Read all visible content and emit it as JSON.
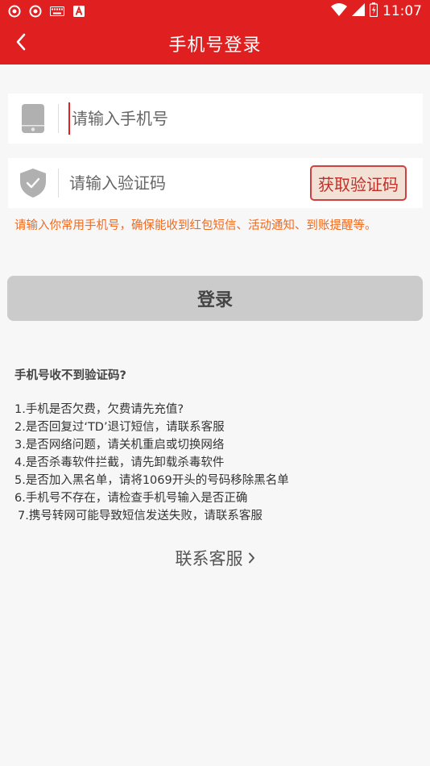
{
  "status_bar": {
    "time": "11:07",
    "left_icons": [
      "app-notification-icon",
      "app-notification-icon",
      "keyboard-icon",
      "text-icon"
    ],
    "right_icons": [
      "wifi-icon",
      "signal-icon",
      "battery-icon"
    ]
  },
  "app_bar": {
    "title": "手机号登录",
    "back_icon": "chevron-left-icon",
    "color": "#e02020"
  },
  "form": {
    "phone": {
      "placeholder": "请输入手机号",
      "value": "",
      "icon": "phone-icon"
    },
    "code": {
      "placeholder": "请输入验证码",
      "value": "",
      "icon": "shield-check-icon"
    },
    "get_code_label": "获取验证码",
    "hint": "请输入你常用手机号，确保能收到红包短信、活动通知、到账提醒等。",
    "login_label": "登录"
  },
  "help": {
    "title": "手机号收不到验证码?",
    "items": [
      "1.手机是否欠费，欠费请先充值?",
      "2.是否回复过‘TD’退订短信，请联系客服",
      "3.是否网络问题，请关机重启或切换网络",
      "4.是否杀毒软件拦截，请先卸载杀毒软件",
      "5.是否加入黑名单，请将1069开头的号码移除黑名单",
      "6.手机号不存在，请检查手机号输入是否正确",
      "7.携号转网可能导致短信发送失败，请联系客服"
    ]
  },
  "contact": {
    "label": "联系客服",
    "icon": "chevron-right-icon"
  },
  "colors": {
    "brand": "#e02020",
    "hint": "#f06a20",
    "disabled_button": "#cbcbcb",
    "background": "#f7f7f7"
  }
}
